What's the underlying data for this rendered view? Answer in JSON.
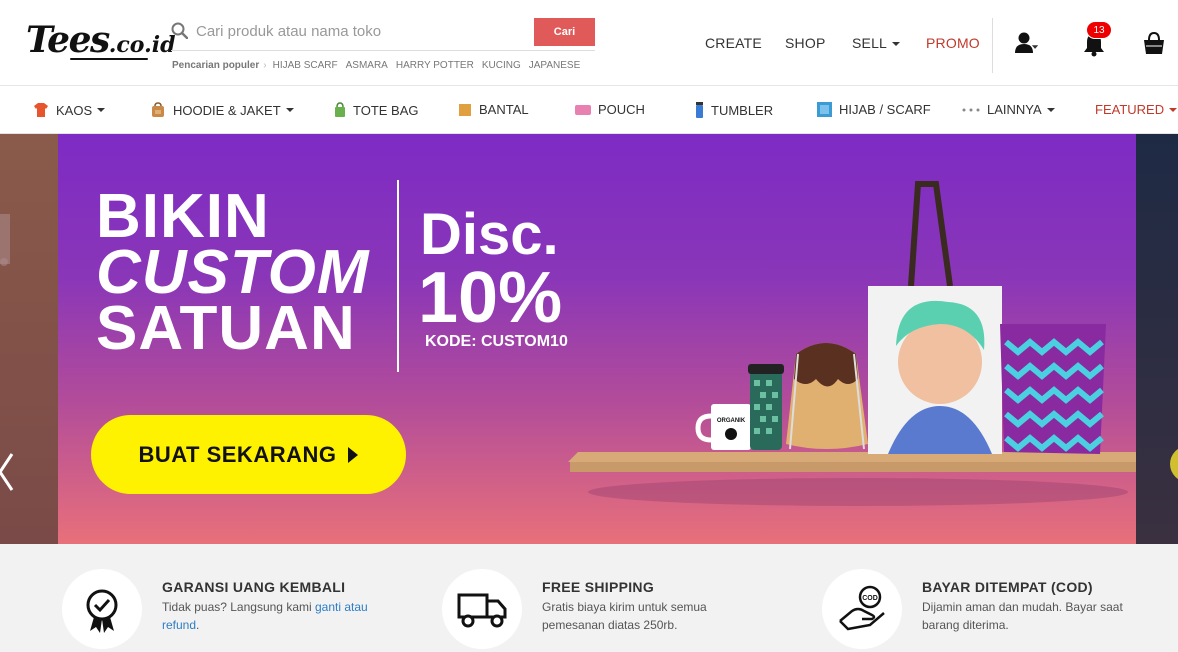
{
  "header": {
    "logo": {
      "main": "Tees",
      "suffix": ".co.id"
    },
    "search": {
      "placeholder": "Cari produk atau nama toko",
      "button": "Cari"
    },
    "popular": {
      "label": "Pencarian populer",
      "terms": [
        "HIJAB SCARF",
        "ASMARA",
        "HARRY POTTER",
        "KUCING",
        "JAPANESE"
      ]
    },
    "nav": {
      "create": "CREATE",
      "shop": "SHOP",
      "sell": "SELL",
      "promo": "PROMO"
    },
    "notifications": {
      "count": "13"
    },
    "icons": {
      "user": "user-icon",
      "bell": "bell-icon",
      "cart": "shopping-bag-icon",
      "search": "search-icon"
    }
  },
  "categories": [
    {
      "label": "KAOS",
      "icon": "tshirt-icon",
      "color": "#e8542d"
    },
    {
      "label": "HOODIE & JAKET",
      "icon": "backpack-icon",
      "color": "#c8894a"
    },
    {
      "label": "TOTE BAG",
      "icon": "tote-bag-icon",
      "color": "#6ab04c"
    },
    {
      "label": "BANTAL",
      "icon": "pillow-icon",
      "color": "#e0a040"
    },
    {
      "label": "POUCH",
      "icon": "pouch-icon",
      "color": "#e880b0"
    },
    {
      "label": "TUMBLER",
      "icon": "tumbler-icon",
      "color": "#3a7bd5"
    },
    {
      "label": "HIJAB / SCARF",
      "icon": "scarf-icon",
      "color": "#3a9bd5"
    },
    {
      "label": "LAINNYA",
      "icon": "more-dots-icon",
      "color": "#888888"
    },
    {
      "label": "FEATURED",
      "icon": "",
      "color": "#c0392b"
    }
  ],
  "hero": {
    "line1": "BIKIN",
    "line2": "CUSTOM",
    "line3": "SATUAN",
    "disc": "Disc.",
    "percent": "10%",
    "code": "KODE: CUSTOM10",
    "cta": "BUAT SEKARANG",
    "mug_text": "ORGANIK"
  },
  "features": [
    {
      "title": "GARANSI UANG KEMBALI",
      "desc_prefix": "Tidak puas? Langsung kami ",
      "link": "ganti atau refund",
      "desc_suffix": ".",
      "icon": "guarantee-badge-icon"
    },
    {
      "title": "FREE SHIPPING",
      "desc": "Gratis biaya kirim untuk semua pemesanan diatas 250rb.",
      "icon": "delivery-truck-icon"
    },
    {
      "title": "BAYAR DITEMPAT (COD)",
      "desc": "Dijamin aman dan mudah. Bayar saat barang diterima.",
      "icon": "cod-hand-icon",
      "badge": "COD"
    }
  ]
}
